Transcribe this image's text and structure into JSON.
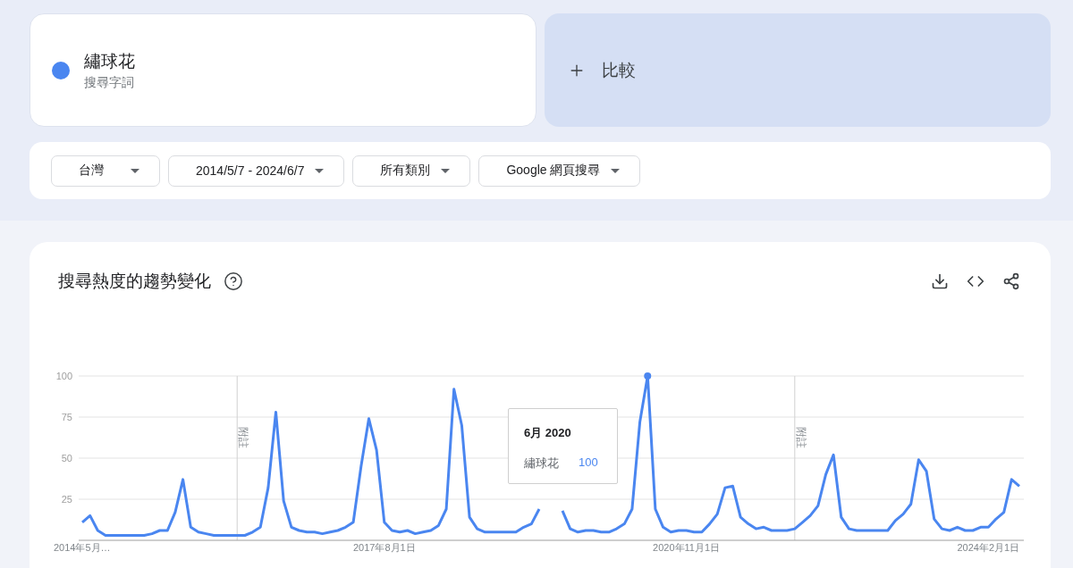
{
  "search_term": {
    "label": "繡球花",
    "sublabel": "搜尋字詞",
    "color": "#4a86f0"
  },
  "compare": {
    "label": "比較"
  },
  "filters": [
    {
      "label": "台灣"
    },
    {
      "label": "2014/5/7 - 2024/6/7"
    },
    {
      "label": "所有類別"
    },
    {
      "label": "Google 網頁搜尋"
    }
  ],
  "trend_card": {
    "title": "搜尋熱度的趨勢變化",
    "notes": [
      {
        "label": "附註"
      },
      {
        "label": "附註"
      }
    ],
    "tooltip": {
      "title": "6月 2020",
      "value": "100"
    },
    "chart_data": {
      "type": "line",
      "grid": true,
      "ylim": [
        0,
        100
      ],
      "categories": [
        "2014年5月…",
        null,
        null,
        null,
        null,
        null,
        null,
        null,
        null,
        null,
        null,
        null,
        null,
        null,
        null,
        null,
        null,
        null,
        null,
        null,
        null,
        null,
        null,
        null,
        null,
        null,
        null,
        null,
        null,
        null,
        null,
        null,
        null,
        null,
        null,
        null,
        null,
        null,
        null,
        "2017年8月1日",
        null,
        null,
        null,
        null,
        null,
        null,
        null,
        null,
        null,
        null,
        null,
        null,
        null,
        null,
        null,
        null,
        null,
        null,
        null,
        null,
        null,
        null,
        null,
        null,
        null,
        null,
        null,
        null,
        null,
        null,
        null,
        null,
        null,
        null,
        null,
        null,
        null,
        null,
        "2020年11月1日",
        null,
        null,
        null,
        null,
        null,
        null,
        null,
        null,
        null,
        null,
        null,
        null,
        null,
        null,
        null,
        null,
        null,
        null,
        null,
        null,
        null,
        null,
        null,
        null,
        null,
        null,
        null,
        null,
        null,
        null,
        null,
        null,
        null,
        null,
        null,
        null,
        null,
        null,
        "2024年2月1日",
        null,
        null,
        null,
        null
      ],
      "yticks": [
        25,
        50,
        75,
        100
      ],
      "series": [
        {
          "name": "繡球花",
          "color": "#4a86f0",
          "values": [
            11,
            15,
            6,
            3,
            3,
            3,
            3,
            3,
            3,
            4,
            6,
            6,
            17,
            37,
            8,
            5,
            4,
            3,
            3,
            3,
            3,
            3,
            5,
            8,
            32,
            78,
            24,
            8,
            6,
            5,
            5,
            4,
            5,
            6,
            8,
            11,
            45,
            74,
            55,
            11,
            6,
            5,
            6,
            4,
            5,
            6,
            9,
            19,
            92,
            70,
            14,
            7,
            5,
            5,
            5,
            5,
            5,
            8,
            10,
            19,
            null,
            null,
            18,
            7,
            5,
            6,
            6,
            5,
            5,
            7,
            10,
            19,
            72,
            100,
            19,
            8,
            5,
            6,
            6,
            5,
            5,
            10,
            16,
            32,
            33,
            14,
            10,
            7,
            8,
            6,
            6,
            6,
            7,
            11,
            15,
            21,
            40,
            52,
            14,
            7,
            6,
            6,
            6,
            6,
            6,
            12,
            16,
            22,
            49,
            42,
            13,
            7,
            6,
            8,
            6,
            6,
            8,
            8,
            13,
            17,
            37,
            33
          ]
        }
      ]
    }
  }
}
